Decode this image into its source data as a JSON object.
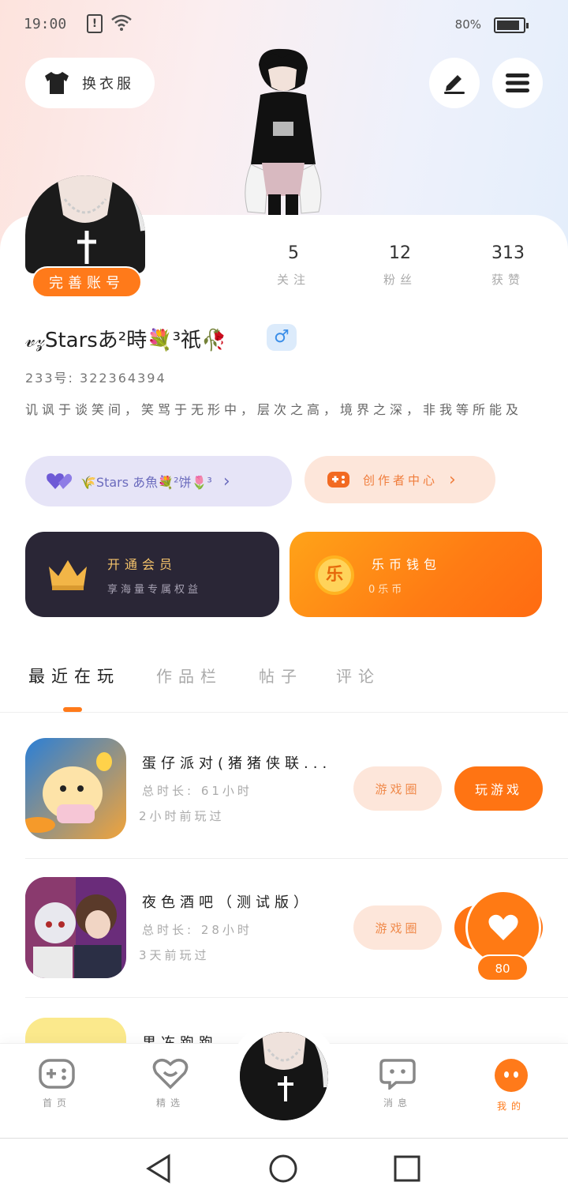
{
  "status_bar": {
    "time": "19:00",
    "battery": "80%",
    "battery_level": 0.8
  },
  "header": {
    "outfit_label": "换衣服"
  },
  "profile": {
    "complete_account": "完善账号",
    "stats": [
      {
        "value": "5",
        "label": "关注"
      },
      {
        "value": "12",
        "label": "粉丝"
      },
      {
        "value": "313",
        "label": "获赞"
      }
    ],
    "nickname": "𝓋𝓏Starsあ²時💐³祇🥀",
    "gender_symbol": "♂",
    "id_line": "233号: 322364394",
    "bio": "讥讽于谈笑间，笑骂于无形中，层次之高，境界之深，非我等所能及",
    "guild_label": "🌾Stars あ魚💐²饼🌷³",
    "creator_label": "创作者中心"
  },
  "cards": {
    "vip_title": "开通会员",
    "vip_subtitle": "享海量专属权益",
    "wallet_title": "乐币钱包",
    "wallet_subtitle": "0乐币",
    "wallet_icon_char": "乐"
  },
  "tabs": [
    "最近在玩",
    "作品栏",
    "帖子",
    "评论"
  ],
  "games": [
    {
      "title": "蛋仔派对(猪猪侠联...",
      "duration": "总时长: 61小时",
      "last_played": "2小时前玩过",
      "circle_label": "游戏圈",
      "play_label": "玩游戏"
    },
    {
      "title": "夜色酒吧（测试版）",
      "duration": "总时长: 28小时",
      "last_played": "3天前玩过",
      "circle_label": "游戏圈",
      "play_label": "玩游戏"
    },
    {
      "title": "果冻跑跑",
      "duration": "",
      "last_played": "",
      "circle_label": "",
      "play_label": ""
    }
  ],
  "fab": {
    "count": "80"
  },
  "bottom_nav": [
    {
      "label": "首页",
      "icon": "gamepad-icon"
    },
    {
      "label": "精选",
      "icon": "heart-smile-icon"
    },
    {
      "label": "",
      "icon": "avatar"
    },
    {
      "label": "消息",
      "icon": "chat-bubble-icon"
    },
    {
      "label": "我的",
      "icon": "face-icon"
    }
  ],
  "colors": {
    "accent": "#ff7a1a",
    "vip_bg": "#2a2636",
    "guild_bg": "#e6e4f7",
    "creator_bg": "#fde6da"
  }
}
